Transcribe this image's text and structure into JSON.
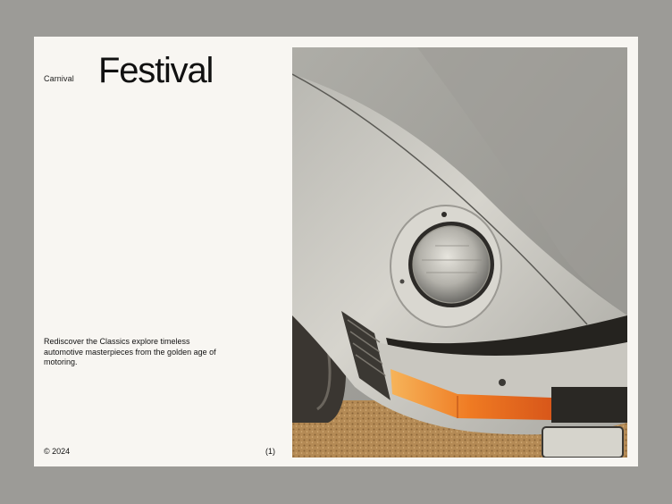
{
  "header": {
    "eyebrow": "Carnival",
    "title": "Festival"
  },
  "body": {
    "description": "Rediscover the Classics explore timeless automotive masterpieces from the golden age of motoring."
  },
  "footer": {
    "copyright": "© 2024",
    "page_number": "(1)"
  },
  "colors": {
    "backdrop": "#9c9b97",
    "card": "#f8f6f2",
    "text": "#111111",
    "car_body": "#cfcdc6",
    "indicator": "#f08a2a"
  }
}
